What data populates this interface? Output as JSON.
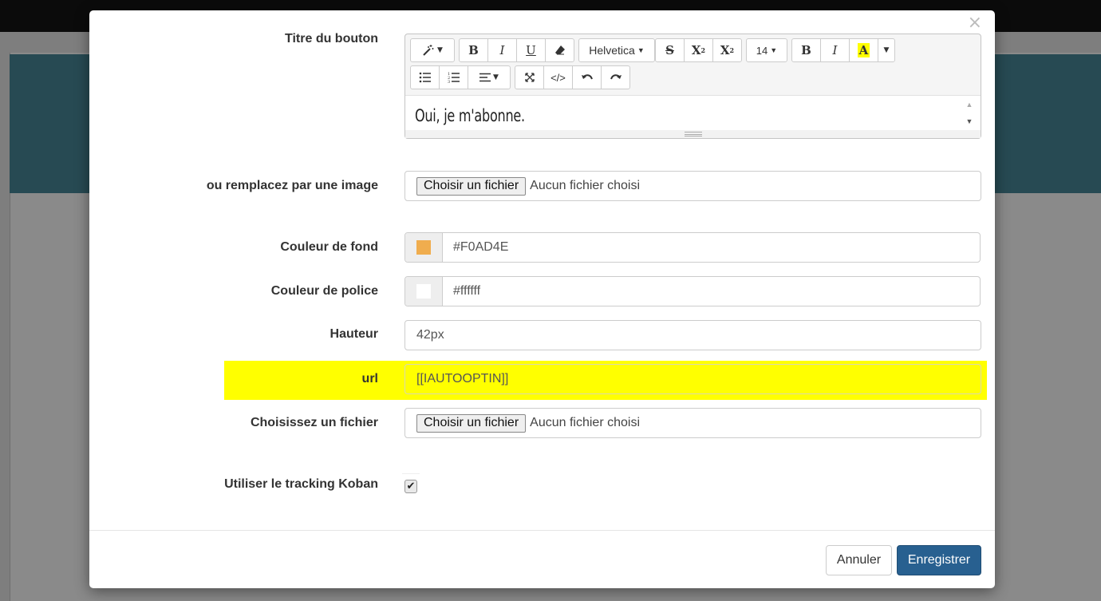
{
  "modal": {
    "close": "×",
    "fields": {
      "button_title": {
        "label": "Titre du bouton",
        "content": "Oui, je m'abonne."
      },
      "image": {
        "label": "ou remplacez par une image",
        "button": "Choisir un fichier",
        "status": "Aucun fichier choisi"
      },
      "bg_color": {
        "label": "Couleur de fond",
        "value": "#F0AD4E",
        "swatch": "#F0AD4E"
      },
      "font_color": {
        "label": "Couleur de police",
        "value": "#ffffff",
        "swatch": "#ffffff"
      },
      "height": {
        "label": "Hauteur",
        "value": "42px"
      },
      "url": {
        "label": "url",
        "value": "[[IAUTOOPTIN]]",
        "highlight": "#ffff00"
      },
      "file": {
        "label": "Choisissez un fichier",
        "button": "Choisir un fichier",
        "status": "Aucun fichier choisi"
      },
      "tracking": {
        "label": "Utiliser le tracking Koban",
        "checked": true
      }
    },
    "toolbar": {
      "magic": "magic-wand-icon",
      "bold": "B",
      "italic": "I",
      "underline": "U",
      "eraser": "eraser-icon",
      "font_name": "Helvetica",
      "strike": "S",
      "superscript": "X",
      "subscript": "X",
      "font_size": "14",
      "bold2": "B",
      "italic2": "I",
      "highlight": "A",
      "highlight_color": "#ffff00"
    },
    "footer": {
      "cancel": "Annuler",
      "save": "Enregistrer"
    }
  }
}
